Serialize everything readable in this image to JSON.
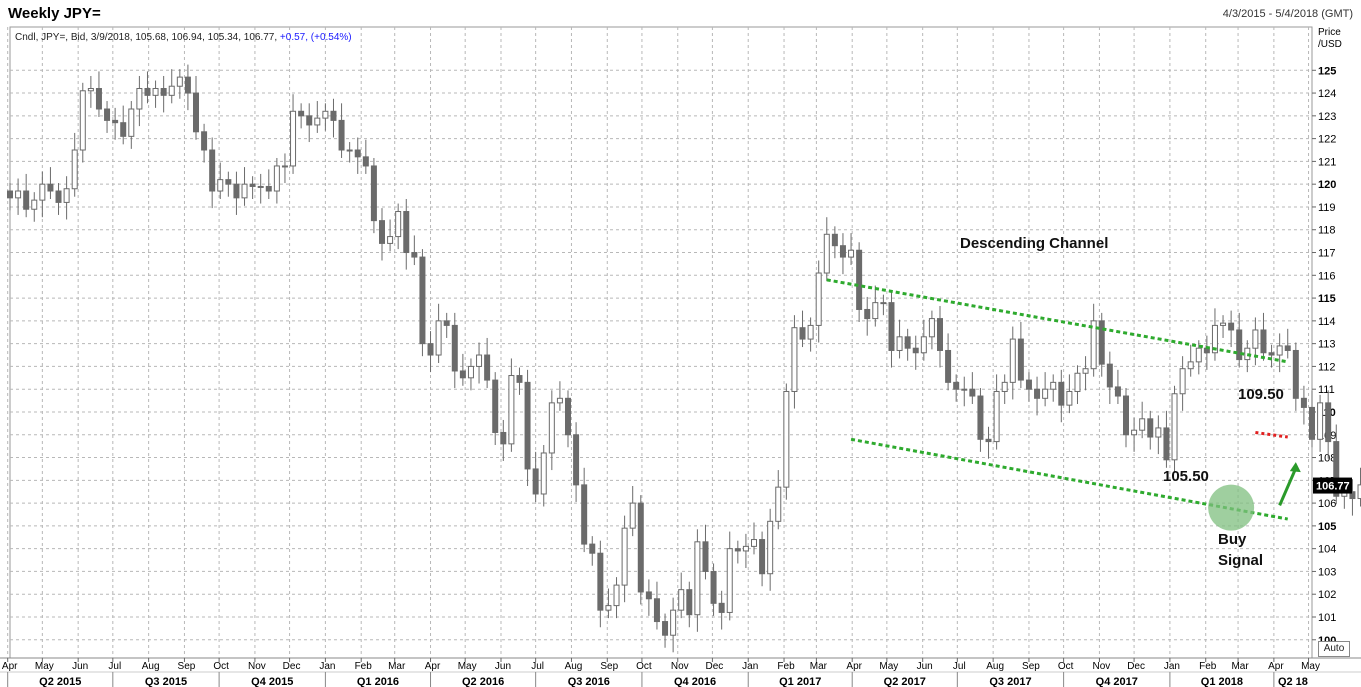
{
  "header": {
    "title": "Weekly JPY=",
    "date_range": "4/3/2015 - 5/4/2018 (GMT)",
    "legend_prefix": "Cndl, JPY=, Bid, 3/9/2018, 105.68, 106.94, 105.34, 106.77,",
    "legend_change": "+0.57, (+0.54%)",
    "auto_label": "Auto"
  },
  "colors": {
    "candle": "#6b6b6b",
    "channel": "#2eaa2e",
    "resistance": "#e02020",
    "signal_circle": "#7fbf7f",
    "arrow": "#2a9a2a",
    "price_tag": "#000000"
  },
  "chart_data": {
    "type": "candlestick",
    "ylabel": "Price\n/USD",
    "ylim": [
      99.2,
      126.9
    ],
    "y_ticks": [
      100,
      101,
      102,
      103,
      104,
      105,
      106,
      107,
      108,
      109,
      110,
      111,
      112,
      113,
      114,
      115,
      116,
      117,
      118,
      119,
      120,
      121,
      122,
      123,
      124,
      125
    ],
    "y_bold_ticks": [
      100,
      105,
      110,
      115,
      120,
      125
    ],
    "last_price": "106.77",
    "grid": true,
    "x_start": "2015-04-03",
    "x_end": "2018-05-04",
    "month_ticks": [
      {
        "label": "Apr",
        "date": "2015-04-01"
      },
      {
        "label": "May",
        "date": "2015-05-01"
      },
      {
        "label": "Jun",
        "date": "2015-06-01"
      },
      {
        "label": "Jul",
        "date": "2015-07-01"
      },
      {
        "label": "Aug",
        "date": "2015-08-01"
      },
      {
        "label": "Sep",
        "date": "2015-09-01"
      },
      {
        "label": "Oct",
        "date": "2015-10-01"
      },
      {
        "label": "Nov",
        "date": "2015-11-01"
      },
      {
        "label": "Dec",
        "date": "2015-12-01"
      },
      {
        "label": "Jan",
        "date": "2016-01-01"
      },
      {
        "label": "Feb",
        "date": "2016-02-01"
      },
      {
        "label": "Mar",
        "date": "2016-03-01"
      },
      {
        "label": "Apr",
        "date": "2016-04-01"
      },
      {
        "label": "May",
        "date": "2016-05-01"
      },
      {
        "label": "Jun",
        "date": "2016-06-01"
      },
      {
        "label": "Jul",
        "date": "2016-07-01"
      },
      {
        "label": "Aug",
        "date": "2016-08-01"
      },
      {
        "label": "Sep",
        "date": "2016-09-01"
      },
      {
        "label": "Oct",
        "date": "2016-10-01"
      },
      {
        "label": "Nov",
        "date": "2016-11-01"
      },
      {
        "label": "Dec",
        "date": "2016-12-01"
      },
      {
        "label": "Jan",
        "date": "2017-01-01"
      },
      {
        "label": "Feb",
        "date": "2017-02-01"
      },
      {
        "label": "Mar",
        "date": "2017-03-01"
      },
      {
        "label": "Apr",
        "date": "2017-04-01"
      },
      {
        "label": "May",
        "date": "2017-05-01"
      },
      {
        "label": "Jun",
        "date": "2017-06-01"
      },
      {
        "label": "Jul",
        "date": "2017-07-01"
      },
      {
        "label": "Aug",
        "date": "2017-08-01"
      },
      {
        "label": "Sep",
        "date": "2017-09-01"
      },
      {
        "label": "Oct",
        "date": "2017-10-01"
      },
      {
        "label": "Nov",
        "date": "2017-11-01"
      },
      {
        "label": "Dec",
        "date": "2017-12-01"
      },
      {
        "label": "Jan",
        "date": "2018-01-01"
      },
      {
        "label": "Feb",
        "date": "2018-02-01"
      },
      {
        "label": "Mar",
        "date": "2018-03-01"
      },
      {
        "label": "Apr",
        "date": "2018-04-01"
      },
      {
        "label": "May",
        "date": "2018-05-01"
      }
    ],
    "quarter_ticks": [
      {
        "label": "Q2 2015",
        "date": "2015-04-01",
        "end": "2015-07-01"
      },
      {
        "label": "Q3 2015",
        "date": "2015-07-01",
        "end": "2015-10-01"
      },
      {
        "label": "Q4 2015",
        "date": "2015-10-01",
        "end": "2016-01-01"
      },
      {
        "label": "Q1 2016",
        "date": "2016-01-01",
        "end": "2016-04-01"
      },
      {
        "label": "Q2 2016",
        "date": "2016-04-01",
        "end": "2016-07-01"
      },
      {
        "label": "Q3 2016",
        "date": "2016-07-01",
        "end": "2016-10-01"
      },
      {
        "label": "Q4 2016",
        "date": "2016-10-01",
        "end": "2017-01-01"
      },
      {
        "label": "Q1 2017",
        "date": "2017-01-01",
        "end": "2017-04-01"
      },
      {
        "label": "Q2 2017",
        "date": "2017-04-01",
        "end": "2017-07-01"
      },
      {
        "label": "Q3 2017",
        "date": "2017-07-01",
        "end": "2017-10-01"
      },
      {
        "label": "Q4 2017",
        "date": "2017-10-01",
        "end": "2018-01-01"
      },
      {
        "label": "Q1 2018",
        "date": "2018-01-01",
        "end": "2018-04-01"
      },
      {
        "label": "Q2 18",
        "date": "2018-04-01",
        "end": "2018-05-04"
      }
    ],
    "close": [
      119.4,
      119.7,
      118.9,
      119.3,
      120.0,
      119.7,
      119.2,
      119.8,
      121.5,
      124.1,
      124.2,
      123.3,
      122.8,
      122.7,
      122.1,
      123.3,
      124.2,
      123.9,
      124.2,
      123.9,
      124.3,
      124.7,
      124.0,
      122.3,
      121.5,
      119.7,
      120.2,
      120.0,
      119.4,
      120.0,
      119.9,
      119.9,
      119.7,
      120.8,
      120.8,
      123.2,
      123.0,
      122.6,
      122.9,
      123.2,
      122.8,
      121.5,
      121.5,
      121.2,
      120.8,
      118.4,
      117.4,
      117.7,
      118.8,
      117.0,
      116.8,
      113.0,
      112.5,
      114.0,
      113.8,
      111.8,
      111.5,
      112.0,
      112.5,
      111.4,
      109.1,
      108.6,
      111.6,
      111.3,
      107.5,
      106.4,
      108.2,
      110.4,
      110.6,
      109.0,
      106.8,
      104.2,
      103.8,
      101.3,
      101.5,
      102.4,
      104.9,
      106.0,
      102.1,
      101.8,
      100.8,
      100.2,
      101.3,
      102.2,
      101.1,
      104.3,
      103.0,
      101.6,
      101.2,
      104.0,
      103.9,
      104.1,
      104.4,
      102.9,
      105.2,
      106.7,
      110.9,
      113.7,
      113.2,
      113.8,
      116.1,
      117.8,
      117.3,
      116.8,
      117.1,
      114.5,
      114.1,
      114.8,
      114.8,
      112.7,
      113.3,
      112.8,
      112.6,
      113.3,
      114.1,
      112.7,
      111.3,
      111.0,
      111.0,
      110.7,
      108.8,
      108.7,
      110.9,
      111.3,
      113.2,
      111.4,
      111.0,
      110.6,
      111.0,
      111.3,
      110.3,
      110.9,
      111.7,
      111.9,
      114.0,
      112.1,
      111.1,
      110.7,
      109.0,
      109.2,
      109.7,
      108.9,
      109.3,
      107.9,
      110.8,
      111.9,
      112.2,
      112.8,
      112.6,
      113.8,
      113.9,
      113.6,
      112.3,
      112.8,
      113.6,
      112.6,
      112.5,
      112.9,
      112.7,
      110.6,
      110.2,
      108.8,
      110.4,
      108.7,
      106.3,
      106.5,
      106.2,
      106.8
    ],
    "annotations": [
      {
        "name": "channel-title",
        "text": "Descending Channel"
      },
      {
        "name": "resistance-level",
        "text": "109.50"
      },
      {
        "name": "support-level",
        "text": "105.50"
      },
      {
        "name": "buy-signal",
        "text": "Buy\nSignal"
      }
    ],
    "channel_upper": {
      "from": {
        "date": "2017-03-10",
        "price": 115.8
      },
      "to": {
        "date": "2018-04-13",
        "price": 112.2
      }
    },
    "channel_lower": {
      "from": {
        "date": "2017-03-31",
        "price": 108.8
      },
      "to": {
        "date": "2018-04-13",
        "price": 105.3
      }
    },
    "resistance_line": {
      "from": {
        "date": "2018-03-16",
        "price": 109.1
      },
      "to": {
        "date": "2018-04-13",
        "price": 108.9
      }
    },
    "signal_zone": {
      "date": "2018-02-23",
      "price": 105.8
    },
    "arrow": {
      "from": {
        "date": "2018-04-06",
        "price": 105.9
      },
      "to": {
        "date": "2018-04-20",
        "price": 107.8
      }
    }
  }
}
